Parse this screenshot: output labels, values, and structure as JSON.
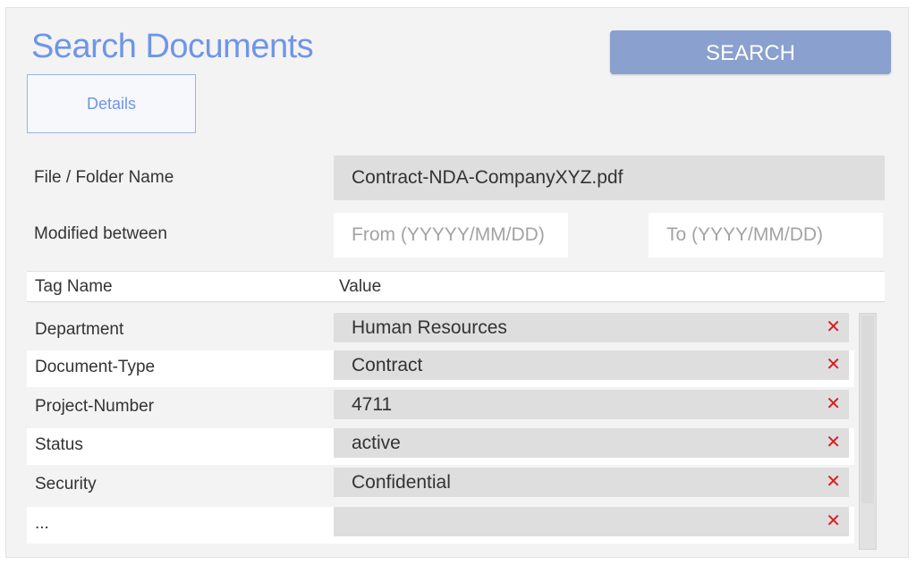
{
  "title": "Search Documents",
  "search_button": "SEARCH",
  "tabs": [
    {
      "label": "Details"
    }
  ],
  "fields": {
    "file_folder_name": {
      "label": "File / Folder Name",
      "value": "Contract-NDA-CompanyXYZ.pdf"
    },
    "modified_between": {
      "label": "Modified between",
      "from_placeholder": "From (YYYYY/MM/DD)",
      "to_placeholder": "To (YYYY/MM/DD)"
    }
  },
  "tag_table": {
    "headers": {
      "tag": "Tag Name",
      "value": "Value"
    },
    "rows": [
      {
        "tag": "Department",
        "value": "Human Resources"
      },
      {
        "tag": "Document-Type",
        "value": "Contract"
      },
      {
        "tag": "Project-Number",
        "value": "4711"
      },
      {
        "tag": "Status",
        "value": "active"
      },
      {
        "tag": "Security",
        "value": "Confidential"
      },
      {
        "tag": "...",
        "value": ""
      }
    ],
    "remove_glyph": "✕"
  },
  "colors": {
    "accent": "#6f95e8",
    "button": "#8aa0ce",
    "remove": "#d81e1e"
  },
  "icons": {
    "remove": "close-icon"
  }
}
